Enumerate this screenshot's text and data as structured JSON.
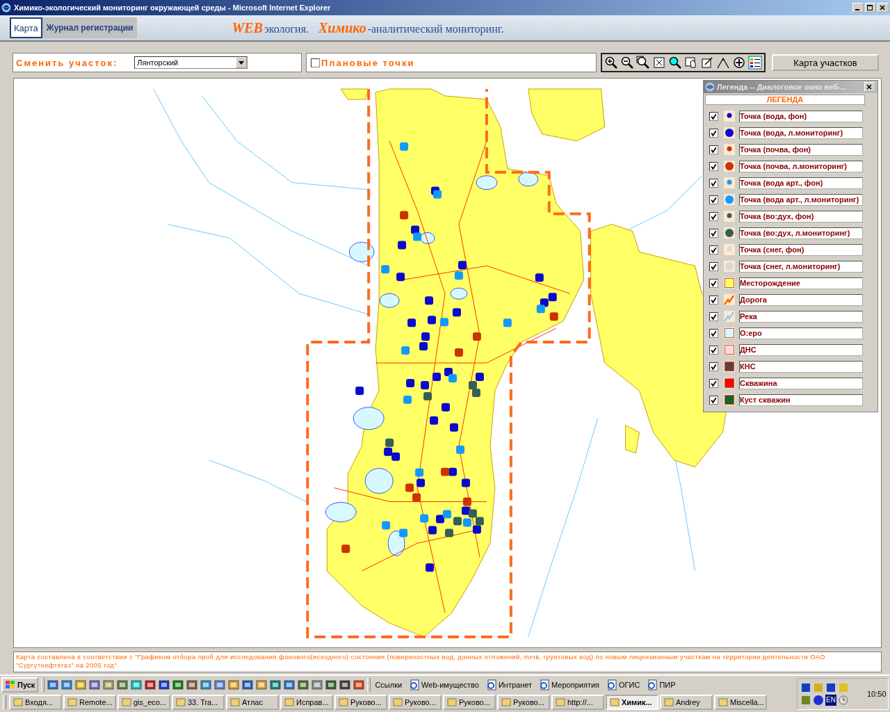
{
  "window": {
    "title": "Химико-экологический мониторинг окружающей среды - Microsoft Internet Explorer"
  },
  "tabs": [
    {
      "label": "Карта",
      "selected": true
    },
    {
      "label": "Журнал регистрации",
      "selected": false
    }
  ],
  "banner": [
    {
      "text": "WEB",
      "kind": "accent"
    },
    {
      "text": "экология.",
      "kind": "plain"
    },
    {
      "text": "Химико",
      "kind": "accent"
    },
    {
      "text": "-аналитический мониторинг.",
      "kind": "plain"
    }
  ],
  "area_selector": {
    "label": "Сменить участок:",
    "value": "Лянторский"
  },
  "planned_points": {
    "label": "Плановые точки",
    "checked": false
  },
  "areas_button": "Карта участков",
  "legend": {
    "title": "Легенда -- Диалоговое окно веб-...",
    "heading": "ЛЕГЕНДА",
    "items": [
      {
        "label": "Точка (вода, фон)",
        "kind": "dot-small",
        "color": "#0a0acc",
        "checked": true
      },
      {
        "label": "Точка (вода, л.мониторинг)",
        "kind": "dot-large",
        "color": "#0a0acc",
        "checked": true
      },
      {
        "label": "Точка (почва, фон)",
        "kind": "dot-small",
        "color": "#cc3300",
        "checked": true
      },
      {
        "label": "Точка (почва, л.мониторинг)",
        "kind": "dot-large",
        "color": "#cc3300",
        "checked": true
      },
      {
        "label": "Точка (вода арт., фон)",
        "kind": "dot-small",
        "color": "#1199ff",
        "checked": true
      },
      {
        "label": "Точка (вода арт., л.мониторинг)",
        "kind": "dot-large",
        "color": "#1199ff",
        "checked": true
      },
      {
        "label": "Точка (во:дух, фон)",
        "kind": "dot-small",
        "color": "#335f55",
        "checked": true
      },
      {
        "label": "Точка (во:дух, л.мониторинг)",
        "kind": "dot-large",
        "color": "#335f55",
        "checked": true
      },
      {
        "label": "Точка (снег, фон)",
        "kind": "dot-small",
        "color": "#d8d8e0",
        "checked": true
      },
      {
        "label": "Точка (снег, л.мониторинг)",
        "kind": "dot-large",
        "color": "#d8d8e0",
        "checked": true
      },
      {
        "label": "Месторождение",
        "kind": "square",
        "color": "#ffff66",
        "checked": true
      },
      {
        "label": "Дорога",
        "kind": "line",
        "color": "#ff6600",
        "checked": true
      },
      {
        "label": "Река",
        "kind": "line",
        "color": "#88ccff",
        "checked": true
      },
      {
        "label": "О:еро",
        "kind": "square",
        "color": "#d8f8ff",
        "checked": true
      },
      {
        "label": "ДНС",
        "kind": "square",
        "color": "#ffd8d8",
        "checked": true
      },
      {
        "label": "КНС",
        "kind": "square",
        "color": "#6a3a3a",
        "checked": true
      },
      {
        "label": "Скважина",
        "kind": "square",
        "color": "#ff0000",
        "checked": true
      },
      {
        "label": "Куст скважин",
        "kind": "square",
        "color": "#1e5e2a",
        "checked": true
      }
    ]
  },
  "footnote": "Карта составлена в соответствии с \"Графиком отбора проб для исследования фонового(исходного) состояния (поверхностных вод, донных отложений, почв, грунтовых вод) по новым лицензионным участкам на территории деятельности ОАО \"Сургутнефтегаз\" на 2005 год\"",
  "taskbar": {
    "start": "Пуск",
    "links": [
      "Ссылки",
      "Web-имущество",
      "Интранет",
      "Мероприятия",
      "ОГИС",
      "ПИР"
    ],
    "tasks": [
      {
        "label": "Входя...",
        "selected": false
      },
      {
        "label": "Remote...",
        "selected": false
      },
      {
        "label": "gis_eco...",
        "selected": false
      },
      {
        "label": "33. Tra...",
        "selected": false
      },
      {
        "label": "Атлас",
        "selected": false
      },
      {
        "label": "Исправ...",
        "selected": false
      },
      {
        "label": "Руково...",
        "selected": false
      },
      {
        "label": "Руково...",
        "selected": false
      },
      {
        "label": "Руково...",
        "selected": false
      },
      {
        "label": "Руково...",
        "selected": false
      },
      {
        "label": "http://...",
        "selected": false
      },
      {
        "label": "Химик...",
        "selected": true
      },
      {
        "label": "Andrey",
        "selected": false
      },
      {
        "label": "Miscella...",
        "selected": false
      }
    ],
    "language": "EN",
    "clock": "10:50"
  }
}
